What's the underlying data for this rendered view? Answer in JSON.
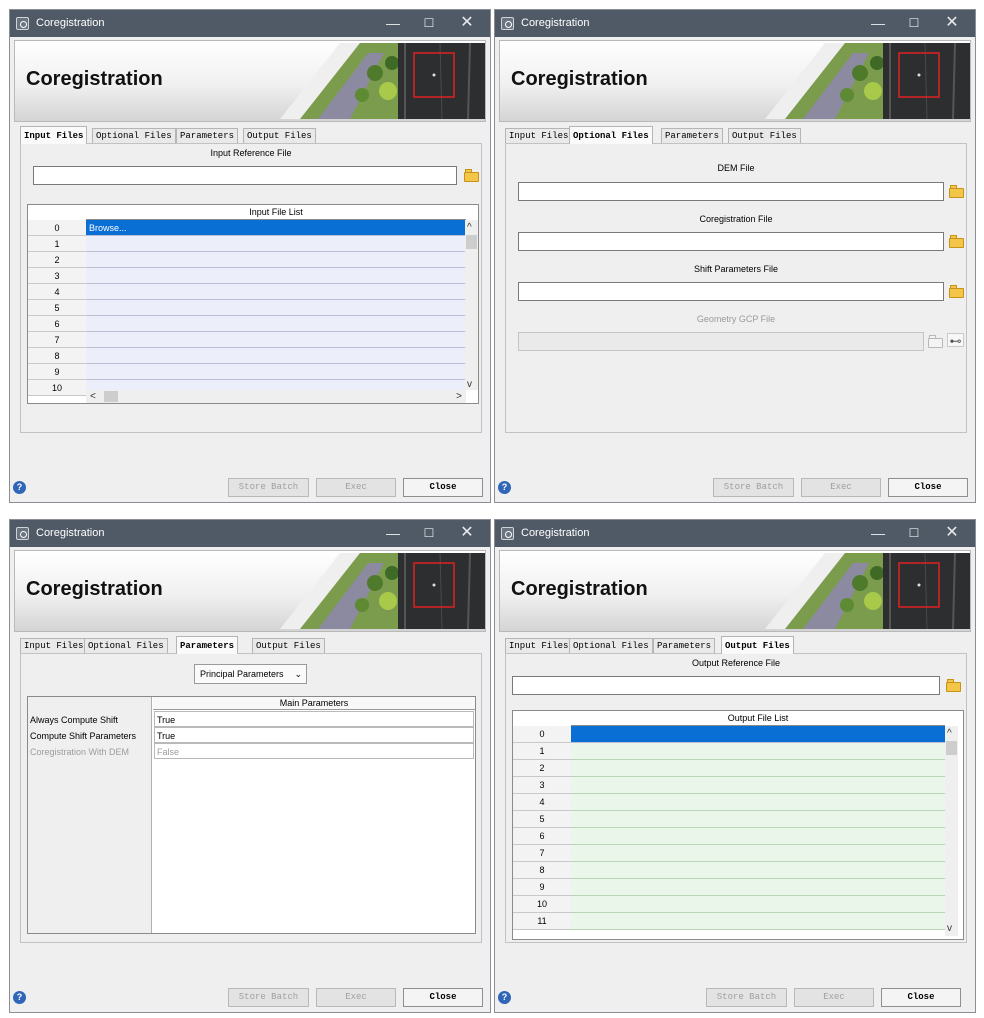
{
  "window": {
    "title": "Coregistration",
    "header_title": "Coregistration",
    "controls": {
      "minimize": "—",
      "maximize": "☐",
      "close": "✕"
    }
  },
  "tabs": [
    "Input Files",
    "Optional Files",
    "Parameters",
    "Output Files"
  ],
  "footer": {
    "store_batch": "Store Batch",
    "exec": "Exec",
    "close": "Close",
    "help_icon": "?"
  },
  "input_files": {
    "reference_label": "Input Reference File",
    "reference_value": "",
    "list_header": "Input File List",
    "rows": [
      {
        "n": "0",
        "v": "Browse..."
      },
      {
        "n": "1",
        "v": ""
      },
      {
        "n": "2",
        "v": ""
      },
      {
        "n": "3",
        "v": ""
      },
      {
        "n": "4",
        "v": ""
      },
      {
        "n": "5",
        "v": ""
      },
      {
        "n": "6",
        "v": ""
      },
      {
        "n": "7",
        "v": ""
      },
      {
        "n": "8",
        "v": ""
      },
      {
        "n": "9",
        "v": ""
      },
      {
        "n": "10",
        "v": ""
      }
    ],
    "selected_row": 0
  },
  "optional_files": {
    "dem_label": "DEM File",
    "coreg_label": "Coregistration File",
    "shift_label": "Shift Parameters File",
    "gcp_label": "Geometry GCP File"
  },
  "parameters": {
    "combo_value": "Principal Parameters",
    "column_header": "Main Parameters",
    "rows": [
      {
        "label": "Always Compute Shift",
        "value": "True",
        "enabled": true
      },
      {
        "label": "Compute Shift Parameters",
        "value": "True",
        "enabled": true
      },
      {
        "label": "Coregistration With DEM",
        "value": "False",
        "enabled": false
      }
    ]
  },
  "output_files": {
    "reference_label": "Output Reference File",
    "reference_value": "",
    "list_header": "Output File List",
    "rows": [
      "0",
      "1",
      "2",
      "3",
      "4",
      "5",
      "6",
      "7",
      "8",
      "9",
      "10",
      "11"
    ],
    "selected_row": 0
  },
  "colors": {
    "titlebar": "#505a66",
    "selection": "#0a6fd4",
    "input_row": "#eceef9",
    "output_row": "#e9f6e9"
  }
}
